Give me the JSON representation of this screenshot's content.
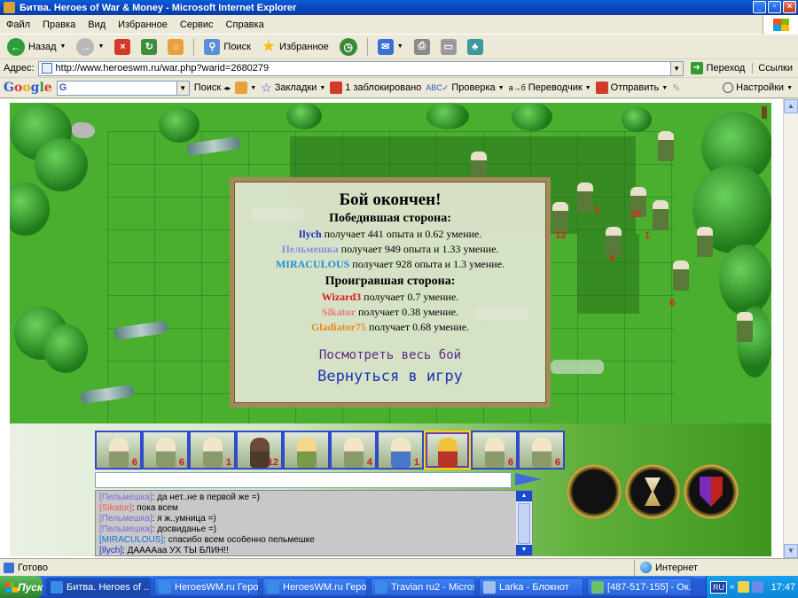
{
  "window": {
    "title": "Битва. Heroes of War & Money - Microsoft Internet Explorer"
  },
  "menu": [
    "Файл",
    "Правка",
    "Вид",
    "Избранное",
    "Сервис",
    "Справка"
  ],
  "toolbar": {
    "back": "Назад",
    "search": "Поиск",
    "favorites": "Избранное"
  },
  "address": {
    "label": "Адрес:",
    "url": "http://www.heroeswm.ru/war.php?warid=2680279",
    "go": "Переход",
    "links": "Ссылки"
  },
  "google": {
    "logo": "Google",
    "search_label": "Поиск",
    "bookmarks": "Закладки",
    "blocked": "1 заблокировано",
    "check": "Проверка",
    "translate": "Переводчик",
    "send": "Отправить",
    "settings": "Настройки"
  },
  "battle": {
    "unit_numbers": [
      "12",
      "3",
      "20",
      "1",
      "4",
      "6"
    ],
    "dialog": {
      "title": "Бой окончен!",
      "winners_title": "Победившая сторона:",
      "winners": [
        {
          "name": "Ilych",
          "text": "получает 441 опыта и 0.62 умение.",
          "color": "#1a28c8"
        },
        {
          "name": "Пельмешка",
          "text": "получает 949 опыта и 1.33 умение.",
          "color": "#8a8ae6"
        },
        {
          "name": "MIRACULOUS",
          "text": "получает 928 опыта и 1.3 умение.",
          "color": "#1e8ed8"
        }
      ],
      "losers_title": "Проигравшая сторона:",
      "losers": [
        {
          "name": "Wizard3",
          "text": "получает 0.7 умение.",
          "color": "#d81818"
        },
        {
          "name": "Sikator",
          "text": "получает 0.38 умение.",
          "color": "#e87a7a"
        },
        {
          "name": "Gladiator75",
          "text": "получает 0.68 умение.",
          "color": "#e88a18"
        }
      ],
      "view_battle": "Посмотреть весь бой",
      "return_game": "Вернуться в игру"
    }
  },
  "portraits": [
    {
      "num": "6"
    },
    {
      "num": "6"
    },
    {
      "num": "1"
    },
    {
      "num": "12"
    },
    {
      "num": ""
    },
    {
      "num": "4"
    },
    {
      "num": "1"
    },
    {
      "num": ""
    },
    {
      "num": "6"
    },
    {
      "num": "6"
    }
  ],
  "chat": [
    {
      "name": "[Пельмешка]",
      "text": ": да нет..не в первой же =)",
      "color": "#7a6ad8"
    },
    {
      "name": "[Sikator]",
      "text": ": пока всем",
      "color": "#e85a5a"
    },
    {
      "name": "[Пельмешка]",
      "text": ": я ж..умница =)",
      "color": "#7a6ad8"
    },
    {
      "name": "[Пельмешка]",
      "text": ": досвиданье =)",
      "color": "#7a6ad8"
    },
    {
      "name": "[MIRACULOUS]",
      "text": ": спасибо всем особенно пельмешке",
      "color": "#1e6ed8"
    },
    {
      "name": "[Ilych]",
      "text": ": ДААААаа УХ ТЫ БЛИН!!",
      "color": "#1a28c8"
    }
  ],
  "status": {
    "text": "Готово",
    "zone": "Интернет"
  },
  "taskbar": {
    "start": "Пуск",
    "tasks": [
      "Битва. Heroes of ...",
      "HeroesWM.ru Геро...",
      "HeroesWM.ru Геро...",
      "Travian ru2 - Micros...",
      "Larka - Блокнот",
      "[487-517-155] - Ок..."
    ],
    "lang": "RU",
    "clock": "17:47"
  }
}
